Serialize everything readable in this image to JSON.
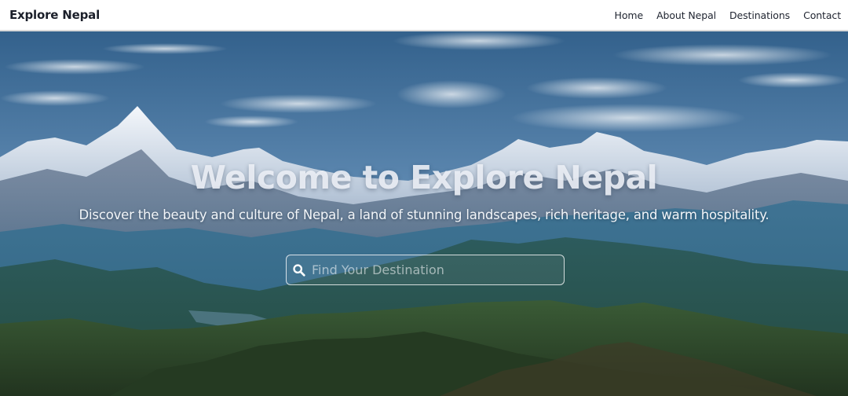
{
  "nav": {
    "brand": "Explore Nepal",
    "links": [
      {
        "label": "Home"
      },
      {
        "label": "About Nepal"
      },
      {
        "label": "Destinations"
      },
      {
        "label": "Contact"
      }
    ]
  },
  "hero": {
    "title": "Welcome to Explore Nepal",
    "subtitle": "Discover the beauty and culture of Nepal, a land of stunning landscapes, rich heritage, and warm hospitality.",
    "search": {
      "placeholder": "Find Your Destination",
      "value": "",
      "icon": "search-icon"
    }
  },
  "colors": {
    "navbar_bg": "#ffffff",
    "nav_text": "#1f2430",
    "hero_title": "#ecf0f6",
    "sky_top": "#3f6f98",
    "valley": "#2f4a3a"
  }
}
